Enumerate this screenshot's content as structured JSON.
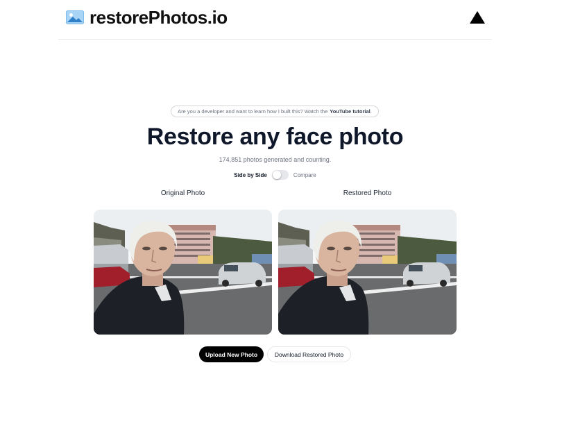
{
  "header": {
    "brand_name": "restorePhotos.io",
    "logo_icon": "landscape-photo-icon",
    "deploy_icon": "vercel-triangle-icon"
  },
  "announcement": {
    "text": "Are you a developer and want to learn how I built this? Watch the",
    "link_text": "YouTube tutorial",
    "suffix": "."
  },
  "hero": {
    "title": "Restore any face photo",
    "counter": "174,851 photos generated and counting."
  },
  "view_toggle": {
    "left_label": "Side by Side",
    "right_label": "Compare",
    "state": "side-by-side"
  },
  "panels": {
    "original_title": "Original Photo",
    "restored_title": "Restored Photo"
  },
  "actions": {
    "upload_label": "Upload New Photo",
    "download_label": "Download Restored Photo"
  },
  "colors": {
    "primary_button": "#000000",
    "heading": "#0f172a",
    "muted_text": "#6b7280",
    "border": "#e5e7eb"
  }
}
